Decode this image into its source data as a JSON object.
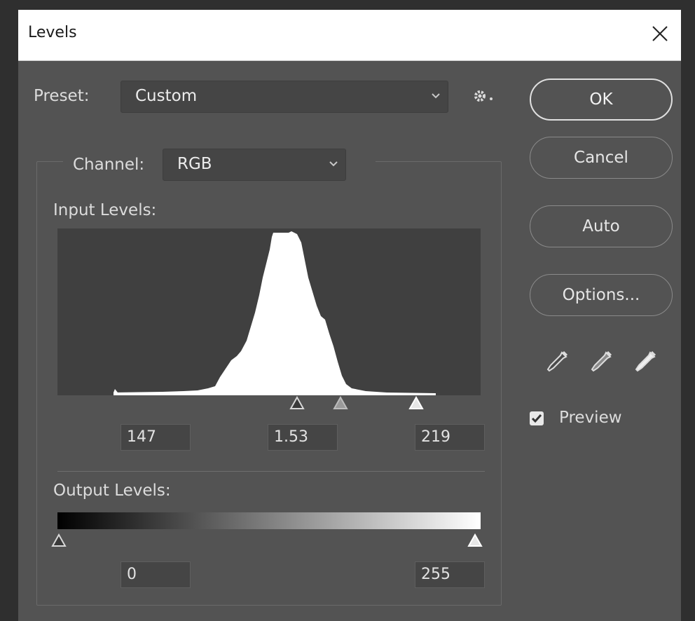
{
  "window": {
    "title": "Levels"
  },
  "preset": {
    "label": "Preset:",
    "value": "Custom"
  },
  "channel": {
    "label": "Channel:",
    "value": "RGB"
  },
  "input_levels": {
    "label": "Input Levels:",
    "black": "147",
    "gamma": "1.53",
    "white": "219"
  },
  "output_levels": {
    "label": "Output Levels:",
    "black": "0",
    "white": "255"
  },
  "buttons": {
    "ok": "OK",
    "cancel": "Cancel",
    "auto": "Auto",
    "options": "Options..."
  },
  "preview": {
    "label": "Preview",
    "checked": true
  },
  "icons": {
    "close": "close-icon",
    "settings": "gear-icon",
    "eyedroppers": [
      "black-point-eyedropper-icon",
      "gray-point-eyedropper-icon",
      "white-point-eyedropper-icon"
    ]
  },
  "colors": {
    "panel": "#535353",
    "histogram_bg": "#404040",
    "histogram_fill": "#ffffff"
  }
}
